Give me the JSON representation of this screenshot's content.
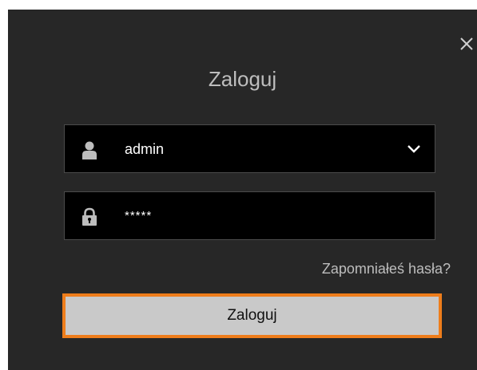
{
  "dialog": {
    "title": "Zaloguj",
    "close_icon": "close-icon"
  },
  "username": {
    "icon": "user-icon",
    "value": "admin",
    "dropdown_icon": "chevron-down-icon"
  },
  "password": {
    "icon": "lock-icon",
    "value": "*****"
  },
  "forgot_link": "Zapomniałeś hasła?",
  "login_button": "Zaloguj",
  "colors": {
    "dialog_bg": "#272727",
    "field_bg": "#000000",
    "button_bg": "#c9c9c9",
    "focus_outline": "#ee7d1b"
  }
}
